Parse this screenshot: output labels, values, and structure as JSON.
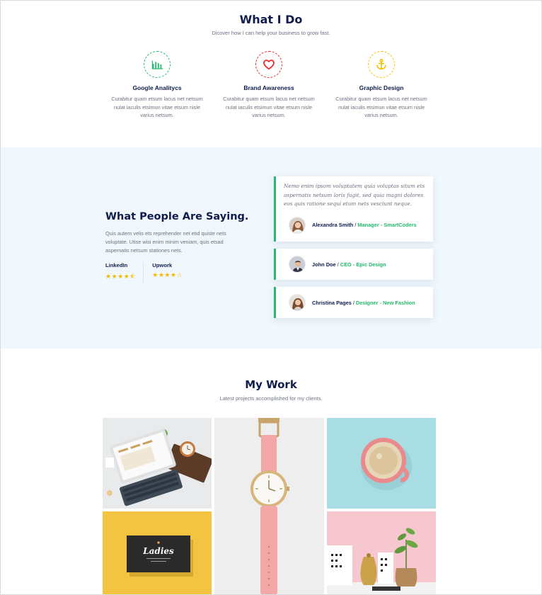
{
  "what_i_do": {
    "title": "What I Do",
    "subtitle": "Dicover how I can help your business to grow fast.",
    "services": [
      {
        "icon": "bar-chart-icon",
        "color": "#26b96f",
        "title": "Google Analitycs",
        "text": "Curabitur quam etsum lacus net netsum nulat iaculis etsimun vitae etsum nisle varius netsum."
      },
      {
        "icon": "heart-icon",
        "color": "#e8282b",
        "title": "Brand Awareness",
        "text": "Curabitur quam etsum lacus net netsum nulat iaculis etsimun vitae etsum nisle varius netsum."
      },
      {
        "icon": "anchor-icon",
        "color": "#f5c000",
        "title": "Graphic Design",
        "text": "Curabitur quam etsum lacus net netsum nulat iaculis etsimun vitae etsum nisle varius netsum."
      }
    ]
  },
  "testimonials": {
    "title": "What People Are Saying.",
    "text": "Quis autem velis ets reprehender net etid quiste nets voluptate. Utise wisi enim minim veniam, quis etsad aspernatis netsum stationes nets.",
    "ratings": [
      {
        "name": "LinkedIn",
        "stars": "★★★★⯪",
        "score": 4.5
      },
      {
        "name": "Upwork",
        "stars": "★★★★☆",
        "score": 4
      }
    ],
    "cards": [
      {
        "quote": "Nemo enim ipsom voluptatem quia voluptas situm ets aspernatis netsum loris fugit, sed quia magni dolores eos quis ratione sequi etum nets vesciunt neque.",
        "name": "Alexandra Smith",
        "separator": "/",
        "role": "Manager - SmartCoders"
      },
      {
        "quote": "",
        "name": "John Doe",
        "separator": "/",
        "role": "CEO - Epic Design"
      },
      {
        "quote": "",
        "name": "Christina Pages",
        "separator": "/",
        "role": "Designer - New Fashion"
      }
    ],
    "accent_color": "#26b96f"
  },
  "my_work": {
    "title": "My Work",
    "subtitle": "Latest projects accomplished for my clients.",
    "tiles": [
      {
        "name": "tablet-mockup-image"
      },
      {
        "name": "watch-image"
      },
      {
        "name": "coffee-cup-image"
      },
      {
        "name": "business-card-image",
        "label": "Ladies"
      },
      {
        "name": "stationery-plant-image"
      }
    ]
  }
}
